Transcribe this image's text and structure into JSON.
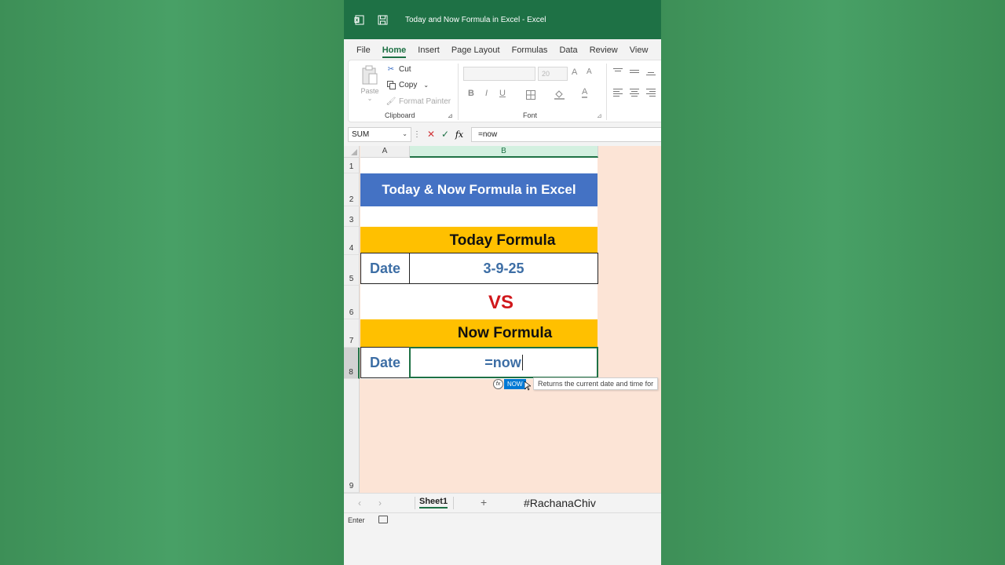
{
  "window": {
    "title": "Today and Now Formula in Excel  -  Excel"
  },
  "menu": {
    "tabs": [
      "File",
      "Home",
      "Insert",
      "Page Layout",
      "Formulas",
      "Data",
      "Review",
      "View"
    ],
    "active": "Home"
  },
  "ribbon": {
    "clipboard": {
      "paste": "Paste",
      "cut": "Cut",
      "copy": "Copy",
      "format_painter": "Format Painter",
      "label": "Clipboard"
    },
    "font": {
      "font_name": "",
      "font_size": "20",
      "bold": "B",
      "italic": "I",
      "underline": "U",
      "grow": "A",
      "shrink": "A",
      "color": "A",
      "label": "Font"
    }
  },
  "formula_bar": {
    "name_box": "SUM",
    "fx": "fx",
    "cancel": "✕",
    "enter": "✓",
    "content": "=now"
  },
  "grid": {
    "columns": [
      "A",
      "B"
    ],
    "rows": [
      "1",
      "2",
      "3",
      "4",
      "5",
      "6",
      "7",
      "8",
      "9"
    ],
    "cells": {
      "b2": "Today & Now Formula in Excel",
      "b4": "Today Formula",
      "a5": "Date",
      "b5": "3-9-25",
      "b6": "VS",
      "b7": "Now Formula",
      "a8": "Date",
      "b8": "=now"
    }
  },
  "autocomplete": {
    "fx": "fx",
    "item": "NOW",
    "tooltip": "Returns the current date and time for"
  },
  "sheets": {
    "tabs": [
      "Sheet1"
    ],
    "add": "+",
    "hashtag": "#RachanaChiv",
    "prev": "‹",
    "next": "›"
  },
  "status": {
    "mode": "Enter"
  },
  "colors": {
    "excel_green": "#1e7145",
    "banner_blue": "#4472c4",
    "orange": "#ffc000",
    "vs_red": "#d0181c",
    "cell_bg": "#fce4d6"
  }
}
